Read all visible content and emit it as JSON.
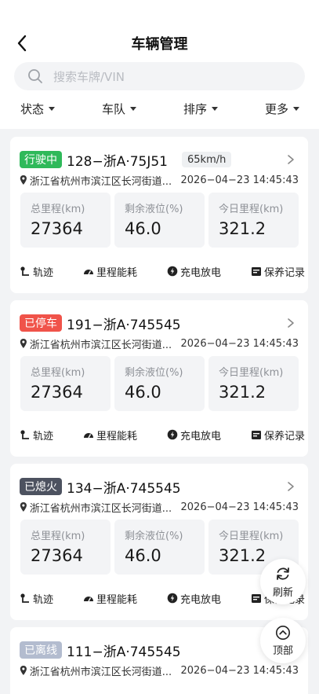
{
  "header": {
    "title": "车辆管理"
  },
  "search": {
    "placeholder": "搜索车牌/VIN"
  },
  "filters": [
    {
      "label": "状态"
    },
    {
      "label": "车队"
    },
    {
      "label": "排序"
    },
    {
      "label": "更多"
    }
  ],
  "colors": {
    "driving": "#2fb95a",
    "parked": "#f0534a",
    "off": "#4d5260",
    "offline": "#b3bccf"
  },
  "stat_labels": {
    "total": "总里程(km)",
    "fluid": "剩余液位(%)",
    "today": "今日里程(km)"
  },
  "action_labels": {
    "track": "轨迹",
    "energy": "里程能耗",
    "charge": "充电放电",
    "maintain": "保养记录"
  },
  "vehicles": [
    {
      "status": "行驶中",
      "plate": "128−浙A·75J51",
      "speed": "65km/h",
      "address": "浙江省杭州市滨江区长河街道...",
      "time": "2026−04−23 14:45:43",
      "total": "27364",
      "fluid": "46.0",
      "today": "321.2"
    },
    {
      "status": "已停车",
      "plate": "191−浙A·745545",
      "address": "浙江省杭州市滨江区长河街道...",
      "time": "2026−04−23 14:45:43",
      "total": "27364",
      "fluid": "46.0",
      "today": "321.2"
    },
    {
      "status": "已熄火",
      "plate": "134−浙A·745545",
      "address": "浙江省杭州市滨江区长河街道...",
      "time": "2026−04−23 14:45:43",
      "total": "27364",
      "fluid": "46.0",
      "today": "321.2"
    },
    {
      "status": "已离线",
      "plate": "111−浙A·745545",
      "address": "浙江省杭州市滨江区长河街道...",
      "time": "2026−04−23 14:45:43"
    }
  ],
  "floating": {
    "refresh": "刷新",
    "top": "顶部"
  }
}
